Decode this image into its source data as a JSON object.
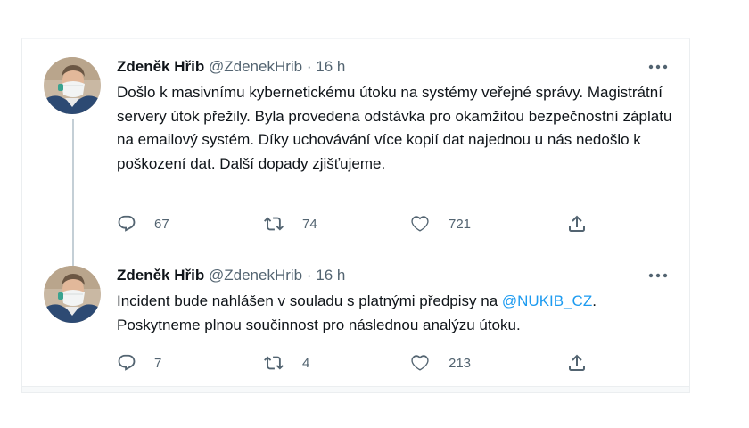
{
  "tweets": [
    {
      "author": {
        "name": "Zdeněk Hřib",
        "handle": "@ZdenekHrib",
        "separator": "·",
        "time": "16 h"
      },
      "text": "Došlo k masivnímu kybernetickému útoku na systémy veřejné správy. Magistrátní servery útok přežily. Byla provedena odstávka pro okamžitou bezpečnostní záplatu na emailový systém. Díky uchovávání více kopií dat najednou u nás nedošlo k poškození dat. Další dopady zjišťujeme.",
      "stats": {
        "replies": "67",
        "retweets": "74",
        "likes": "721"
      },
      "more_icon": "ellipsis-icon"
    },
    {
      "author": {
        "name": "Zdeněk Hřib",
        "handle": "@ZdenekHrib",
        "separator": "·",
        "time": "16 h"
      },
      "text_before": "Incident bude nahlášen v souladu s platnými předpisy na ",
      "mention": "@NUKIB_CZ",
      "text_after": ". Poskytneme plnou součinnost pro následnou analýzu útoku.",
      "stats": {
        "replies": "7",
        "retweets": "4",
        "likes": "213"
      },
      "more_icon": "ellipsis-icon"
    }
  ],
  "icons": {
    "reply": "reply-icon",
    "retweet": "retweet-icon",
    "like": "heart-icon",
    "share": "share-icon"
  },
  "colors": {
    "text": "#0f1419",
    "secondary": "#536471",
    "link": "#1d9bf0",
    "thread_line": "#c4cfd6",
    "border": "#ebeef0"
  }
}
